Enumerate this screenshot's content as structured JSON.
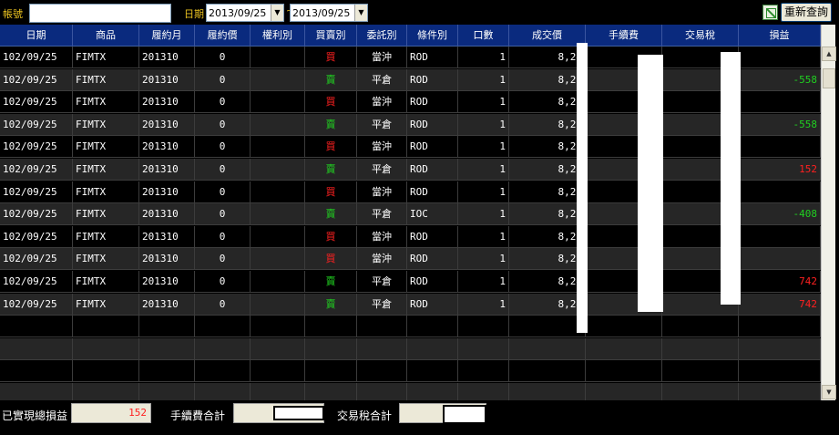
{
  "toolbar": {
    "account_label": "帳號",
    "account_value": "",
    "date_label": "日期",
    "date_from": "2013/09/25",
    "date_to": "2013/09/25",
    "date_separator": "~",
    "requery_label": "重新查詢",
    "export_icon": "excel-export-icon"
  },
  "table": {
    "columns": [
      "日期",
      "商品",
      "履約月",
      "履約價",
      "權利別",
      "買賣別",
      "委託別",
      "條件別",
      "口數",
      "成交價",
      "手續費",
      "交易稅",
      "損益"
    ],
    "rows": [
      {
        "date": "102/09/25",
        "product": "FIMTX",
        "month": "201310",
        "strike": "0",
        "right": "",
        "side": "買",
        "order": "當沖",
        "cond": "ROD",
        "qty": "1",
        "price": "8,24",
        "fee": "",
        "tax": "",
        "pnl": ""
      },
      {
        "date": "102/09/25",
        "product": "FIMTX",
        "month": "201310",
        "strike": "0",
        "right": "",
        "side": "賣",
        "order": "平倉",
        "cond": "ROD",
        "qty": "1",
        "price": "8,23",
        "fee": "",
        "tax": "",
        "pnl": "-558"
      },
      {
        "date": "102/09/25",
        "product": "FIMTX",
        "month": "201310",
        "strike": "0",
        "right": "",
        "side": "買",
        "order": "當沖",
        "cond": "ROD",
        "qty": "1",
        "price": "8,23",
        "fee": "",
        "tax": "",
        "pnl": ""
      },
      {
        "date": "102/09/25",
        "product": "FIMTX",
        "month": "201310",
        "strike": "0",
        "right": "",
        "side": "賣",
        "order": "平倉",
        "cond": "ROD",
        "qty": "1",
        "price": "8,23",
        "fee": "",
        "tax": "",
        "pnl": "-558"
      },
      {
        "date": "102/09/25",
        "product": "FIMTX",
        "month": "201310",
        "strike": "0",
        "right": "",
        "side": "買",
        "order": "當沖",
        "cond": "ROD",
        "qty": "1",
        "price": "8,23",
        "fee": "",
        "tax": "",
        "pnl": ""
      },
      {
        "date": "102/09/25",
        "product": "FIMTX",
        "month": "201310",
        "strike": "0",
        "right": "",
        "side": "賣",
        "order": "平倉",
        "cond": "ROD",
        "qty": "1",
        "price": "8,24",
        "fee": "",
        "tax": "",
        "pnl": "152"
      },
      {
        "date": "102/09/25",
        "product": "FIMTX",
        "month": "201310",
        "strike": "0",
        "right": "",
        "side": "買",
        "order": "當沖",
        "cond": "ROD",
        "qty": "1",
        "price": "8,23",
        "fee": "",
        "tax": "",
        "pnl": ""
      },
      {
        "date": "102/09/25",
        "product": "FIMTX",
        "month": "201310",
        "strike": "0",
        "right": "",
        "side": "賣",
        "order": "平倉",
        "cond": "IOC",
        "qty": "1",
        "price": "8,22",
        "fee": "",
        "tax": "",
        "pnl": "-408"
      },
      {
        "date": "102/09/25",
        "product": "FIMTX",
        "month": "201310",
        "strike": "0",
        "right": "",
        "side": "買",
        "order": "當沖",
        "cond": "ROD",
        "qty": "1",
        "price": "8,23",
        "fee": "",
        "tax": "",
        "pnl": ""
      },
      {
        "date": "102/09/25",
        "product": "FIMTX",
        "month": "201310",
        "strike": "0",
        "right": "",
        "side": "買",
        "order": "當沖",
        "cond": "ROD",
        "qty": "1",
        "price": "8,23",
        "fee": "",
        "tax": "",
        "pnl": ""
      },
      {
        "date": "102/09/25",
        "product": "FIMTX",
        "month": "201310",
        "strike": "0",
        "right": "",
        "side": "賣",
        "order": "平倉",
        "cond": "ROD",
        "qty": "1",
        "price": "8,24",
        "fee": "",
        "tax": "",
        "pnl": "742"
      },
      {
        "date": "102/09/25",
        "product": "FIMTX",
        "month": "201310",
        "strike": "0",
        "right": "",
        "side": "賣",
        "order": "平倉",
        "cond": "ROD",
        "qty": "1",
        "price": "8,24",
        "fee": "",
        "tax": "",
        "pnl": "742"
      }
    ],
    "empty_rows": 4
  },
  "footer": {
    "realized_pnl_label": "已實現總損益",
    "realized_pnl_value": "152",
    "fee_total_label": "手續費合計",
    "fee_total_value": "",
    "tax_total_label": "交易稅合計",
    "tax_total_value": ""
  },
  "colors": {
    "header_bg": "#0a2a7e",
    "buy": "#ff2020",
    "sell": "#20d020",
    "label_yellow": "#e8c020"
  }
}
